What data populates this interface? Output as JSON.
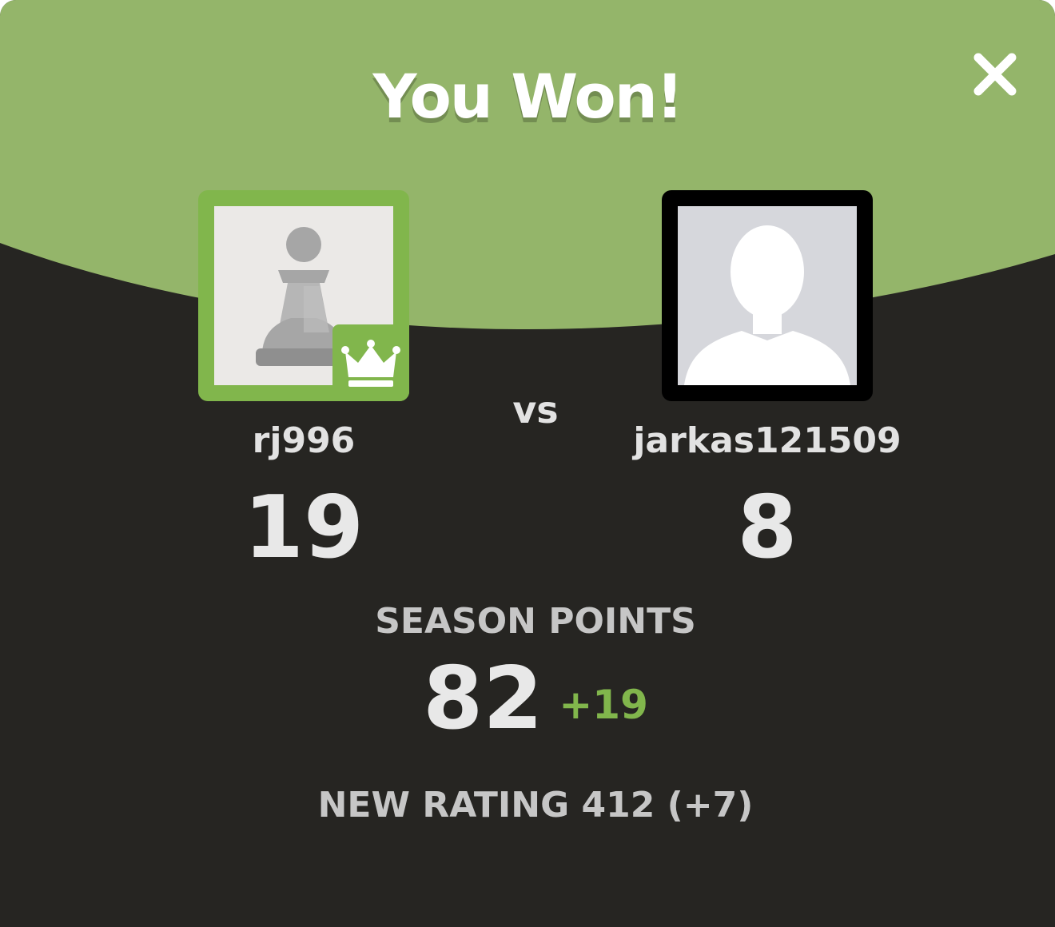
{
  "modal": {
    "title": "You Won!",
    "close_icon": "close-icon"
  },
  "players": {
    "left": {
      "username": "rj996",
      "score": "19",
      "avatar_icon": "pawn-icon",
      "badge_icon": "crown-icon"
    },
    "vs_label": "vs",
    "right": {
      "username": "jarkas121509",
      "score": "8",
      "avatar_icon": "default-user-silhouette-icon"
    }
  },
  "season": {
    "label": "SEASON POINTS",
    "value": "82",
    "delta": "+19"
  },
  "rating": {
    "text": "NEW RATING 412 (+7)"
  },
  "colors": {
    "accent_green": "#81b64c",
    "header_green": "#94b56a",
    "background_dark": "#262522",
    "text_light": "#e2e2e2"
  }
}
